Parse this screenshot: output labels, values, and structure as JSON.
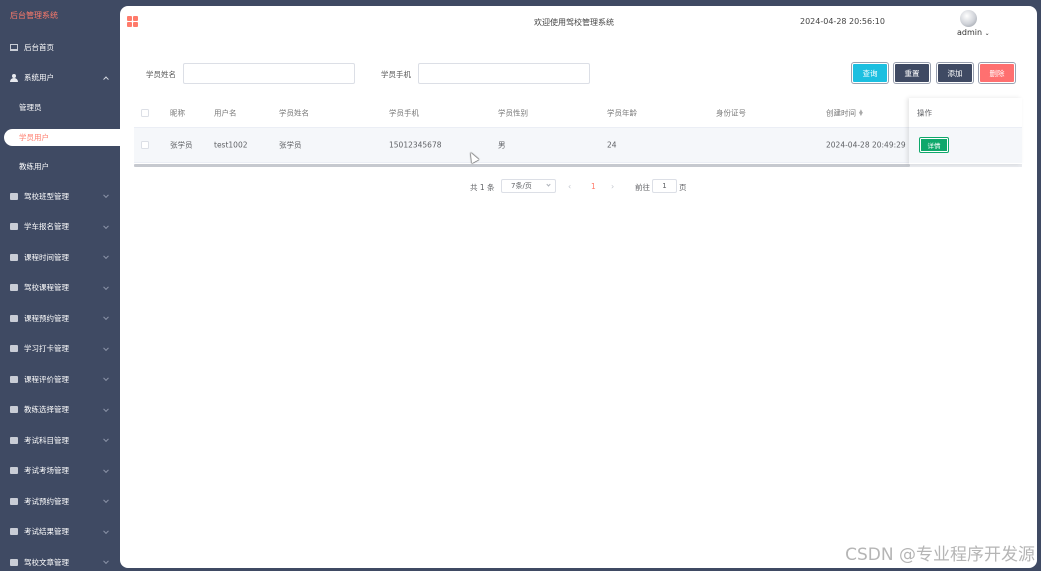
{
  "sidebar": {
    "brand": "后台管理系统",
    "items": [
      {
        "label": "后台首页",
        "icon": "monitor-icon"
      },
      {
        "label": "系统用户",
        "icon": "user-icon",
        "expanded": true,
        "children": [
          {
            "label": "管理员"
          },
          {
            "label": "学员用户",
            "active": true
          },
          {
            "label": "教练用户"
          }
        ]
      },
      {
        "label": "驾校班型管理"
      },
      {
        "label": "学车报名管理"
      },
      {
        "label": "课程时间管理"
      },
      {
        "label": "驾校课程管理"
      },
      {
        "label": "课程预约管理"
      },
      {
        "label": "学习打卡管理"
      },
      {
        "label": "课程评价管理"
      },
      {
        "label": "教练选择管理"
      },
      {
        "label": "考试科目管理"
      },
      {
        "label": "考试考场管理"
      },
      {
        "label": "考试预约管理"
      },
      {
        "label": "考试结果管理"
      },
      {
        "label": "驾校文章管理"
      }
    ]
  },
  "header": {
    "welcome": "欢迎使用驾校管理系统",
    "datetime": "2024-04-28 20:56:10",
    "user": "admin"
  },
  "search": {
    "name_label": "学员姓名",
    "name_value": "",
    "phone_label": "学员手机",
    "phone_value": "",
    "buttons": {
      "search": "查询",
      "reset": "重置",
      "add": "添加",
      "delete": "删除"
    }
  },
  "table": {
    "columns": [
      "昵称",
      "用户名",
      "学员姓名",
      "学员手机",
      "学员性别",
      "学员年龄",
      "身份证号",
      "创建时间",
      "操作"
    ],
    "rows": [
      {
        "nickname": "张学员",
        "username": "test1002",
        "name": "张学员",
        "phone": "15012345678",
        "gender": "男",
        "age": "24",
        "id_number": "",
        "created": "2024-04-28 20:49:29",
        "action": "详情"
      }
    ]
  },
  "pagination": {
    "total": "共 1 条",
    "page_size": "7条/页",
    "current_page": "1",
    "goto_label": "前往",
    "goto_value": "1",
    "page_unit": "页"
  },
  "watermark": "CSDN @专业程序开发源"
}
